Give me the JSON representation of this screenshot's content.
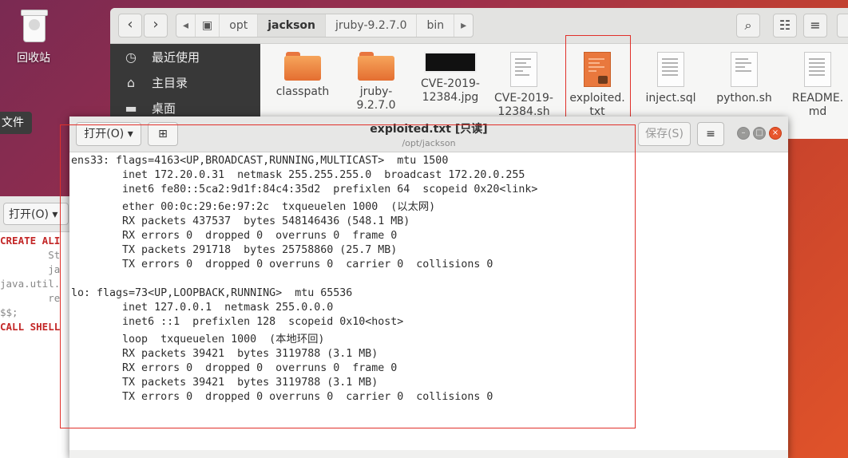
{
  "desktop": {
    "trash_label": "回收站",
    "side_tab_label": "文件"
  },
  "file_manager": {
    "breadcrumbs": [
      "opt",
      "jackson",
      "jruby-9.2.7.0",
      "bin"
    ],
    "current_crumb": "jackson",
    "sidebar": [
      {
        "icon": "clock-icon",
        "label": "最近使用"
      },
      {
        "icon": "home-icon",
        "label": "主目录"
      },
      {
        "icon": "folder-icon",
        "label": "桌面"
      }
    ],
    "files": [
      {
        "kind": "folder",
        "name": "classpath",
        "name2": ""
      },
      {
        "kind": "folder",
        "name": "jruby-",
        "name2": "9.2.7.0"
      },
      {
        "kind": "image",
        "name": "CVE-2019-",
        "name2": "12384.jpg"
      },
      {
        "kind": "doc",
        "name": "CVE-2019-",
        "name2": "12384.sh"
      },
      {
        "kind": "locked-txt",
        "name": "exploited.",
        "name2": "txt"
      },
      {
        "kind": "doc",
        "name": "inject.sql",
        "name2": ""
      },
      {
        "kind": "doc",
        "name": "python.sh",
        "name2": ""
      },
      {
        "kind": "doc",
        "name": "README.",
        "name2": "md"
      }
    ]
  },
  "background_editor": {
    "open_label": "打开(O)",
    "code_lines": [
      "CREATE ALI",
      "        St",
      "        ja",
      "java.util.",
      "        re",
      "$$;",
      "CALL SHELL"
    ]
  },
  "editor": {
    "open_label": "打开(O)",
    "title": "exploited.txt [只读]",
    "path": "/opt/jackson",
    "save_label": "保存(S)",
    "content_lines": [
      "ens33: flags=4163<UP,BROADCAST,RUNNING,MULTICAST>  mtu 1500",
      "        inet 172.20.0.31  netmask 255.255.255.0  broadcast 172.20.0.255",
      "        inet6 fe80::5ca2:9d1f:84c4:35d2  prefixlen 64  scopeid 0x20<link>",
      "        ether 00:0c:29:6e:97:2c  txqueuelen 1000  (以太网)",
      "        RX packets 437537  bytes 548146436 (548.1 MB)",
      "        RX errors 0  dropped 0  overruns 0  frame 0",
      "        TX packets 291718  bytes 25758860 (25.7 MB)",
      "        TX errors 0  dropped 0 overruns 0  carrier 0  collisions 0",
      "",
      "lo: flags=73<UP,LOOPBACK,RUNNING>  mtu 65536",
      "        inet 127.0.0.1  netmask 255.0.0.0",
      "        inet6 ::1  prefixlen 128  scopeid 0x10<host>",
      "        loop  txqueuelen 1000  (本地环回)",
      "        RX packets 39421  bytes 3119788 (3.1 MB)",
      "        RX errors 0  dropped 0  overruns 0  frame 0",
      "        TX packets 39421  bytes 3119788 (3.1 MB)",
      "        TX errors 0  dropped 0 overruns 0  carrier 0  collisions 0"
    ]
  },
  "colors": {
    "highlight_box": "#e0302a",
    "sidebar_bg": "#383838",
    "close_button": "#e8562d"
  }
}
